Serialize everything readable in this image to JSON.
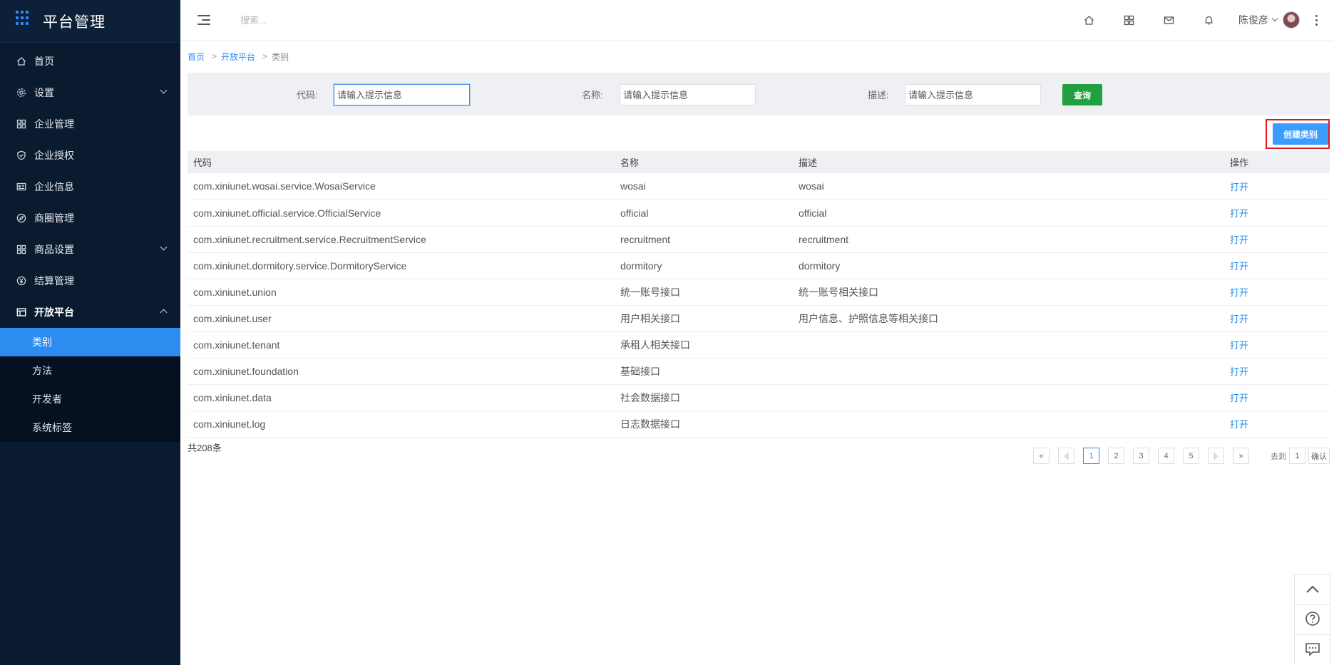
{
  "app": {
    "title": "平台管理"
  },
  "sidebar": {
    "items": [
      {
        "label": "首页",
        "icon": "home-icon"
      },
      {
        "label": "设置",
        "icon": "gear-icon"
      },
      {
        "label": "企业管理",
        "icon": "org-icon"
      },
      {
        "label": "企业授权",
        "icon": "shield-icon"
      },
      {
        "label": "企业信息",
        "icon": "id-card-icon"
      },
      {
        "label": "商圈管理",
        "icon": "compass-icon"
      },
      {
        "label": "商品设置",
        "icon": "grid-icon"
      },
      {
        "label": "结算管理",
        "icon": "yen-icon"
      },
      {
        "label": "开放平台",
        "icon": "table-icon"
      }
    ],
    "submenu": [
      {
        "label": "类别"
      },
      {
        "label": "方法"
      },
      {
        "label": "开发者"
      },
      {
        "label": "系统标签"
      }
    ]
  },
  "header": {
    "search_placeholder": "搜索...",
    "user_name": "陈俊彦"
  },
  "breadcrumb": {
    "home": "首页",
    "parent": "开放平台",
    "current": "类别",
    "sep": ">"
  },
  "filter": {
    "code_label": "代码:",
    "name_label": "名称:",
    "desc_label": "描述:",
    "placeholder": "请输入提示信息",
    "query_button": "查询"
  },
  "toolbar": {
    "create_button": "创建类别"
  },
  "table": {
    "headers": [
      "代码",
      "名称",
      "描述",
      "操作"
    ],
    "rows": [
      {
        "code": "com.xiniunet.wosai.service.WosaiService",
        "name": "wosai",
        "desc": "wosai",
        "op": "打开"
      },
      {
        "code": "com.xiniunet.official.service.OfficialService",
        "name": "official",
        "desc": "official",
        "op": "打开"
      },
      {
        "code": "com.xiniunet.recruitment.service.RecruitmentService",
        "name": "recruitment",
        "desc": "recruitment",
        "op": "打开"
      },
      {
        "code": "com.xiniunet.dormitory.service.DormitoryService",
        "name": "dormitory",
        "desc": "dormitory",
        "op": "打开"
      },
      {
        "code": "com.xiniunet.union",
        "name": "统一账号接口",
        "desc": "统一账号相关接口",
        "op": "打开"
      },
      {
        "code": "com.xiniunet.user",
        "name": "用户相关接口",
        "desc": "用户信息、护照信息等相关接口",
        "op": "打开"
      },
      {
        "code": "com.xiniunet.tenant",
        "name": "承租人相关接口",
        "desc": "",
        "op": "打开"
      },
      {
        "code": "com.xiniunet.foundation",
        "name": "基础接口",
        "desc": "",
        "op": "打开"
      },
      {
        "code": "com.xiniunet.data",
        "name": "社会数据接口",
        "desc": "",
        "op": "打开"
      },
      {
        "code": "com.xiniunet.log",
        "name": "日志数据接口",
        "desc": "",
        "op": "打开"
      }
    ],
    "total": "共208条"
  },
  "pagination": {
    "first": "«",
    "last": "»",
    "pages": [
      "1",
      "2",
      "3",
      "4",
      "5"
    ],
    "current": "1",
    "goto_label": "去到",
    "goto_value": "1",
    "confirm": "确认"
  },
  "colors": {
    "sidebar_bg": "#0a1a2f",
    "accent": "#2d8cf0",
    "query_btn": "#21a041",
    "create_btn": "#3b9cff",
    "highlight_border": "#e8141c"
  }
}
